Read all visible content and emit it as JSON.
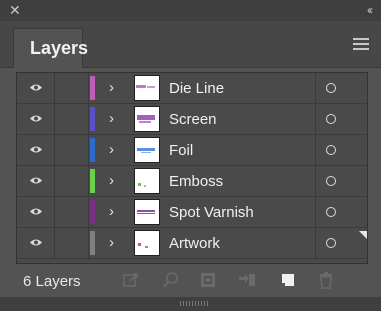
{
  "panel": {
    "tab_label": "Layers",
    "footer_count": "6 Layers"
  },
  "layers": [
    {
      "name": "Die Line",
      "color": "#c05fb8"
    },
    {
      "name": "Screen",
      "color": "#5c4fc6"
    },
    {
      "name": "Foil",
      "color": "#2e6ccc"
    },
    {
      "name": "Emboss",
      "color": "#6ad14a"
    },
    {
      "name": "Spot Varnish",
      "color": "#7a2f86"
    },
    {
      "name": "Artwork",
      "color": "#808080"
    }
  ],
  "icons": {
    "close": "close-icon",
    "collapse": "collapse-icon",
    "menu": "panel-menu-icon",
    "visibility": "eye-icon",
    "expand": "chevron-right-icon",
    "target": "target-circle-icon",
    "footer": [
      "export-icon",
      "search-icon",
      "clipping-mask-icon",
      "move-to-layer-icon",
      "new-layer-icon",
      "trash-icon"
    ]
  },
  "colors": {
    "panel_bg": "#535353",
    "titlebar_bg": "#3f3f3f",
    "list_bg": "#4a4a4a"
  }
}
